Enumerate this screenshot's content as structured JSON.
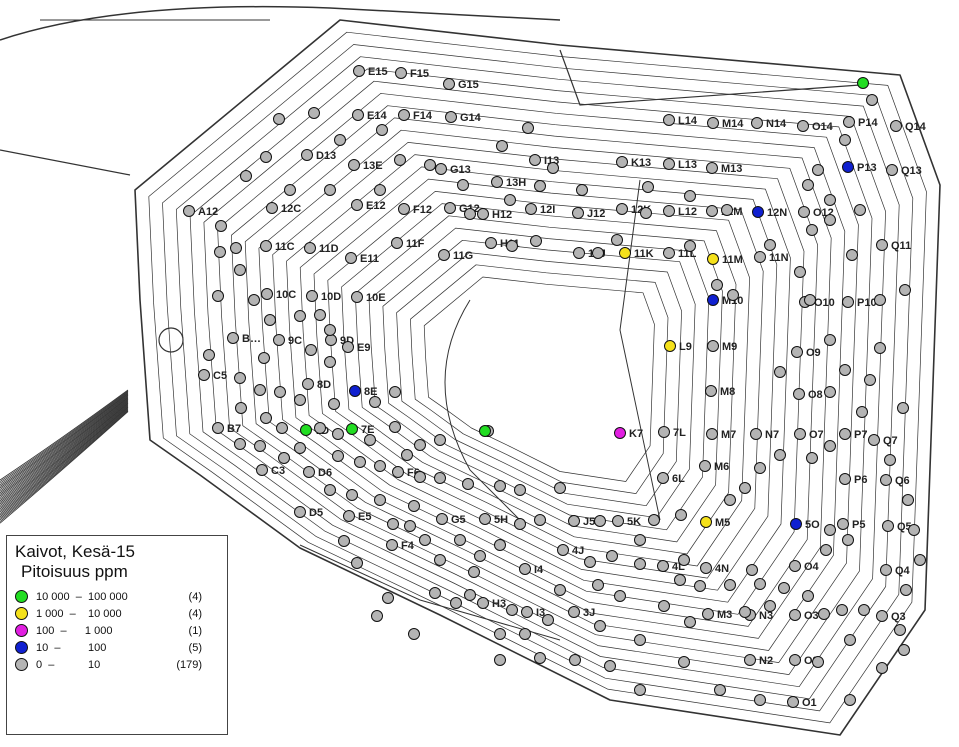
{
  "legend": {
    "title_line1": "Kaivot, Kesä-15",
    "title_line2": "Pitoisuus ppm",
    "classes": [
      {
        "range": "10 000  –  100 000",
        "count": "(4)",
        "color": "#22dd22"
      },
      {
        "range": "1 000  –    10 000",
        "count": "(4)",
        "color": "#f5e11b"
      },
      {
        "range": "100  –      1 000",
        "count": "(1)",
        "color": "#e11ee1"
      },
      {
        "range": "10  –         100",
        "count": "(5)",
        "color": "#1020d0"
      },
      {
        "range": "0  –           10",
        "count": "(179)",
        "color": "#b4b4b4"
      }
    ]
  },
  "wells_labeled": [
    "E15",
    "F15",
    "G15",
    "E14",
    "F14",
    "G14",
    "D13",
    "13E",
    "G13",
    "13H",
    "I13",
    "K13",
    "L13",
    "M13",
    "L14",
    "M14",
    "N14",
    "O14",
    "P14",
    "Q14",
    "P13",
    "Q13",
    "A12",
    "12C",
    "E12",
    "F12",
    "G12",
    "H12",
    "12I",
    "J12",
    "12K",
    "L12",
    "12M",
    "12N",
    "O12",
    "11C",
    "11D",
    "E11",
    "11F",
    "11G",
    "H11",
    "11J",
    "11K",
    "11L",
    "11M",
    "11N",
    "Q11",
    "10C",
    "10D",
    "10E",
    "M10",
    "O10",
    "P10",
    "B…",
    "9C",
    "9D",
    "E9",
    "L9",
    "M9",
    "O9",
    "C5",
    "8D",
    "8E",
    "M8",
    "O8",
    "B7",
    "7D",
    "7E",
    "K7",
    "7L",
    "M7",
    "N7",
    "O7",
    "P7",
    "Q7",
    "C3",
    "D6",
    "F6",
    "6L",
    "M6",
    "P6",
    "Q6",
    "D5",
    "E5",
    "G5",
    "5H",
    "J5",
    "5K",
    "M5",
    "5O",
    "P5",
    "Q5",
    "F4",
    "4J",
    "I4",
    "4L",
    "4N",
    "O4",
    "Q4",
    "H3",
    "I3",
    "3J",
    "M3",
    "N3",
    "O3",
    "Q3",
    "N2",
    "O2",
    "O1"
  ]
}
